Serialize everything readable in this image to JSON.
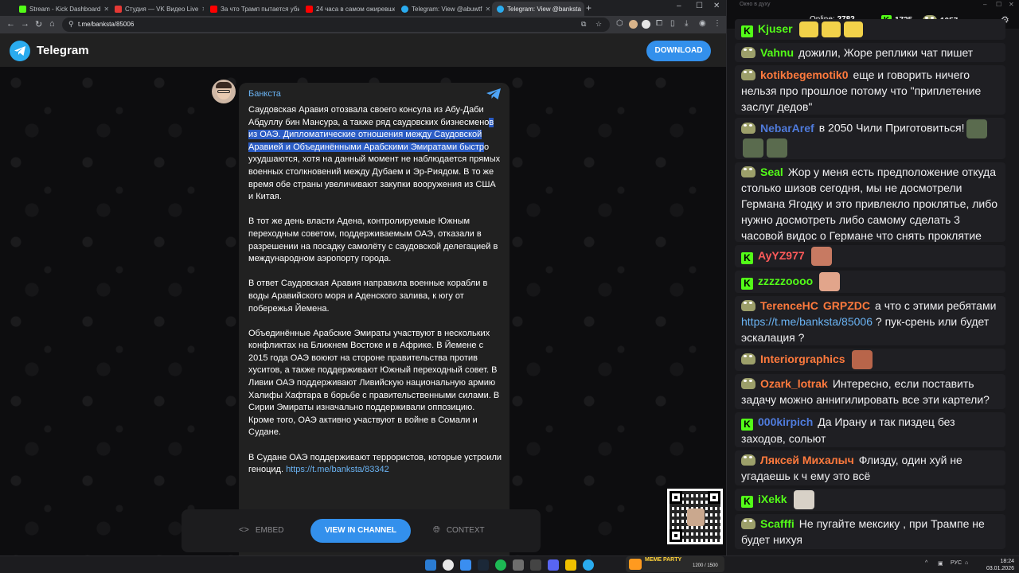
{
  "browser": {
    "tabs": [
      {
        "label": "Stream - Kick Dashboard",
        "color": "#53fc18",
        "active": false
      },
      {
        "label": "Студия — VK Видео Live",
        "color": "#e53935",
        "active": false
      },
      {
        "label": "За что Трамп пытается убить",
        "color": "#ff0000",
        "active": false
      },
      {
        "label": "24 часа в самом ожиревшем",
        "color": "#ff0000",
        "active": false
      },
      {
        "label": "Telegram: View @abuwtf",
        "color": "#2aabee",
        "active": false
      },
      {
        "label": "Telegram: View @banksta",
        "color": "#2aabee",
        "active": true
      }
    ],
    "url": "t.me/banksta/85006"
  },
  "telegram": {
    "app_name": "Telegram",
    "download_label": "DOWNLOAD",
    "channel_name": "Банкста",
    "paragraphs": [
      {
        "before": "Саудовская Аравия отозвала своего консула из Абу-Даби Абдуллу бин Мансура, а также ряд саудовских бизнесмено",
        "highlight": "в из ОАЭ. Дипломатические отношения между Саудовской Аравией и Объединёнными Арабскими Эмиратами быстр",
        "after": "о ухудшаются, хотя на данный момент не наблюдается прямых военных столкновений между Дубаем и Эр-Риядом. В то же время обе страны увеличивают закупки вооружения из США и Китая."
      },
      {
        "text": "В тот же день власти Адена, контролируемые Южным переходным советом, поддерживаемым ОАЭ, отказали в разрешении на посадку самолёту с саудовской делегацией в международном аэропорту города."
      },
      {
        "text": "В ответ Саудовская Аравия направила военные корабли в воды Аравийского моря и Аденского залива, к югу от побережья Йемена."
      },
      {
        "text": "Объединённые Арабские Эмираты участвуют в нескольких конфликтах на Ближнем Востоке и в Африке. В Йемене с 2015 года ОАЭ воюют на стороне правительства против хуситов, а также поддерживают Южный переходный совет. В Ливии ОАЭ поддерживают Ливийскую национальную армию Халифы Хафтара в борьбе с правительственными силами. В Сирии Эмираты изначально поддерживали оппозицию. Кроме того, ОАЭ активно участвуют в войне в Сомали и Судане."
      },
      {
        "text": "В Судане ОАЭ поддерживают террористов, которые устроили геноцид. ",
        "link": "https://t.me/banksta/83342"
      }
    ],
    "actions": {
      "embed": "EMBED",
      "view": "VIEW IN CHANNEL",
      "context": "CONTEXT"
    }
  },
  "chat": {
    "window_title": "Окно в духу",
    "online_label": "Online:",
    "online_count": "2782",
    "kick_count": "1725",
    "pepe_count": "1057",
    "messages": [
      {
        "user": "Kjuser",
        "color": "#53fc18",
        "badge": "kick",
        "text": ""
      },
      {
        "user": "Vahnu",
        "color": "#53fc18",
        "badge": "pepe",
        "text": "дожили, Жоре реплики чат пишет"
      },
      {
        "user": "kotikbegemotik0",
        "color": "#ff7a3d",
        "badge": "pepe",
        "text": "еще и говорить ничего нельзя про прошлое потому что \"приплетение заслуг дедов\""
      },
      {
        "user": "NebarAref",
        "color": "#4f7bdc",
        "badge": "pepe",
        "text": "в 2050 Чили Приготовиться!"
      },
      {
        "user": "Seal",
        "color": "#53fc18",
        "badge": "pepe",
        "text": "Жор у меня есть предположение откуда столько шизов сегодня, мы не досмотрели Германа Ягодку и это привлекло проклятье, либо нужно досмотреть либо самому сделать 3 часовой видос о Германе что снять проклятие"
      },
      {
        "user": "AyYZ977",
        "color": "#ff5a5a",
        "badge": "kick",
        "text": ""
      },
      {
        "user": "zzzzzoooo",
        "color": "#53fc18",
        "badge": "kick",
        "text": ""
      },
      {
        "user": "TerenceHC",
        "user2": "GRPZDC",
        "color": "#ff7a3d",
        "badge": "pepe",
        "text_a": "а что с этими ребятами ",
        "link": "https://t.me/banksta/85006",
        "text_b": " ?  пук-срень или будет эскалация ?"
      },
      {
        "user": "Interiorgraphics",
        "color": "#ff7a3d",
        "badge": "pepe",
        "text": ""
      },
      {
        "user": "Ozark_lotrak",
        "color": "#ff7a3d",
        "badge": "pepe",
        "text": "Интересно, если поставить задачу можно аннигилировать все эти картели?"
      },
      {
        "user": "000kirpich",
        "color": "#4f7bdc",
        "badge": "kick",
        "text": "Да Ирану и так пиздец без заходов, сольют"
      },
      {
        "user": "Ляксей Михалыч",
        "color": "#ff7a3d",
        "badge": "pepe",
        "text": "Флизду, один хуй не угадаешь к ч ему  это всё"
      },
      {
        "user": "iXekk",
        "color": "#53fc18",
        "badge": "kick",
        "text": ""
      },
      {
        "user": "Scafffi",
        "color": "#53fc18",
        "badge": "pepe",
        "text": "Не пугайте мексику , при Трампе не будет нихуя"
      }
    ]
  },
  "taskbar": {
    "meme_party_title": "MEME PARTY",
    "meme_party_score": "1200 / 1500",
    "lang": "РУС",
    "time": "18:24",
    "date": "03.01.2026"
  }
}
